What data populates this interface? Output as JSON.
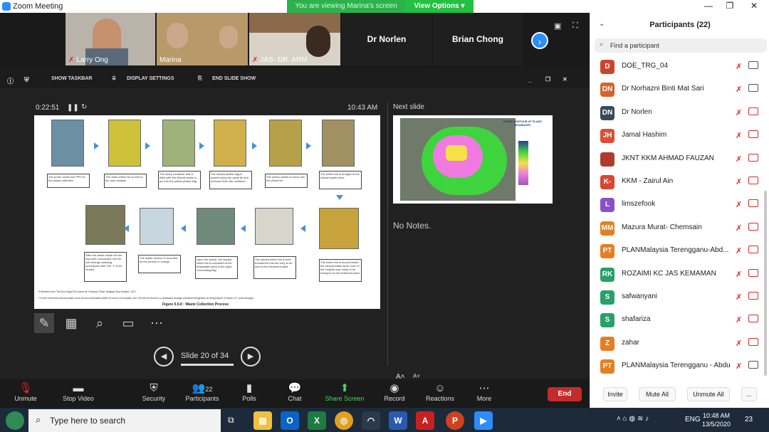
{
  "window": {
    "title": "Zoom Meeting",
    "viewing_banner": "You are viewing Marina's screen",
    "view_options": "View Options"
  },
  "thumbnails": [
    {
      "name": "Larry Ong"
    },
    {
      "name": "Marina"
    },
    {
      "name": "JAS- DR. ARM"
    }
  ],
  "name_tiles": [
    "Dr Norlen",
    "Brian Chong"
  ],
  "presenter": {
    "show_taskbar": "SHOW TASKBAR",
    "display_settings": "DISPLAY SETTINGS",
    "end_slide_show": "END SLIDE SHOW",
    "timer": "0:22:51",
    "clock": "10:43 AM",
    "next_slide_label": "Next slide",
    "notes": "No Notes.",
    "slide_counter": "Slide 20 of 34"
  },
  "slide": {
    "row1_captions": [
      "The porter wears the PPE for the waste collection",
      "The clean wheel bin is sent to the user location",
      "The sharp container that is filled with the clinical waste is put into the yellow plastic bag",
      "The loaded plastic bag is sealed using the cable tie and removed from the container",
      "The yellow plastic is move into the wheel bin",
      "The wheel bin is brought to the clinical waste store"
    ],
    "row2_captions": [
      "After the waste inside the bin has been processed, the bin will undergo washing procedures with 100 °C to be reused",
      "The waste receive is recorded by the person in charge.",
      "Upon the arrival, the loaded wheel bin is unloaded at the designated area in the plant, Concealing Bay",
      "The loaded wheel bin is then transferred into the lorry to be sent to the treatment plant",
      "The wheel bin is moved inside the clinical waste store room in the hospital and ready to be transport to the treatment plant"
    ],
    "footnote1": "*Extracted from The Eco Edge EIA report for 'Kedaran Tidak Tangkap Sisa Klinikal', 2017",
    "footnote2": "**In the event that clinical waste could not be incinerated within 24 hours of reception, the CW will be stored in a dedicated storage container/refrigerator at temperature of below 4°C (cold storage)",
    "figure_caption": "Figure 5.5.8 : Waste Collection Process",
    "next_title": "NOISE CONTOUR AT PLANT BOUNDARY"
  },
  "toolbar": {
    "mute": "Unmute",
    "video": "Stop Video",
    "security": "Security",
    "participants": "Participants",
    "participants_count": "22",
    "polls": "Polls",
    "chat": "Chat",
    "share": "Share Screen",
    "record": "Record",
    "reactions": "Reactions",
    "more": "More",
    "end": "End"
  },
  "panel": {
    "title": "Participants (22)",
    "search_placeholder": "Find a participant",
    "invite": "Invite",
    "mute_all": "Mute All",
    "unmute_all": "Unmute All",
    "more": "..."
  },
  "participants": [
    {
      "initials": "D",
      "name": "DOE_TRG_04",
      "color": "#c9462c",
      "cam_off": false
    },
    {
      "initials": "DN",
      "name": "Dr Norhazni Binti Mat Sari",
      "color": "#d9622b",
      "cam_off": false
    },
    {
      "initials": "DN",
      "name": "Dr Norlen",
      "color": "#3a4a5a",
      "cam_off": true
    },
    {
      "initials": "JH",
      "name": "Jamal Hashim",
      "color": "#d94f35",
      "cam_off": true
    },
    {
      "initials": "",
      "name": "JKNT KKM AHMAD FAUZAN",
      "color": "#b03a2e",
      "cam_off": true
    },
    {
      "initials": "K-",
      "name": "KKM - Zairul Ain",
      "color": "#d9452e",
      "cam_off": true
    },
    {
      "initials": "L",
      "name": "limszefook",
      "color": "#8b4fc7",
      "cam_off": true
    },
    {
      "initials": "MM",
      "name": "Mazura Murat- Chemsain",
      "color": "#e67e22",
      "cam_off": true
    },
    {
      "initials": "PT",
      "name": "PLANMalaysia Terengganu-Abd...",
      "color": "#e67e22",
      "cam_off": true
    },
    {
      "initials": "RK",
      "name": "ROZAIMI KC JAS KEMAMAN",
      "color": "#27a06b",
      "cam_off": true
    },
    {
      "initials": "S",
      "name": "safwanyani",
      "color": "#27a06b",
      "cam_off": true
    },
    {
      "initials": "S",
      "name": "shafariza",
      "color": "#27a06b",
      "cam_off": true
    },
    {
      "initials": "Z",
      "name": "zahar",
      "color": "#e67e22",
      "cam_off": true
    },
    {
      "initials": "PT",
      "name": "PLANMalaysia Terengganu - Abdullah",
      "color": "#e67e22",
      "cam_off": false
    }
  ],
  "taskbar": {
    "search_placeholder": "Type here to search",
    "lang": "ENG",
    "time": "10:48 AM",
    "date": "13/5/2020",
    "notif": "23"
  }
}
